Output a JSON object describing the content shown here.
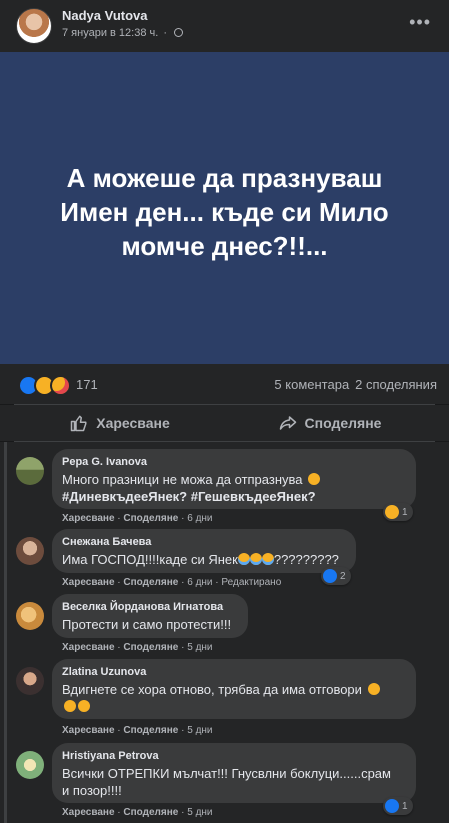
{
  "post": {
    "author": "Nadya Vutova",
    "timestamp": "7 януари в 12:38 ч.",
    "separator": "·",
    "privacy_icon": "globe-icon",
    "more_icon": "more-options-icon",
    "image_text": "А можеше да празнуваш\nИмен ден... къде си Мило\nмомче днес?!!...",
    "image_bg": "#2c3e66"
  },
  "stats": {
    "reactions": [
      "like",
      "sad",
      "care"
    ],
    "reaction_count": "171",
    "comments": "5 коментара",
    "shares": "2 споделяния"
  },
  "actions": {
    "like_label": "Харесване",
    "share_label": "Споделяне"
  },
  "comments": [
    {
      "name": "Pepa G. Ivanova",
      "text_line1": "Много празници не можа да отпразнува ",
      "text_line2": "#ДиневкъдееЯнек? #ГешевкъдееЯнек?",
      "like": "Харесване",
      "reply": "Споделяне",
      "time": "6 дни",
      "reaction_count": "1"
    },
    {
      "name": "Снежана Бачева",
      "text": "Има ГОСПОД!!!!каде си Янек",
      "text_suffix": "?????????",
      "like": "Харесване",
      "reply": "Споделяне",
      "time": "6 дни",
      "edited": "Редактирано",
      "reaction_count": "2"
    },
    {
      "name": "Веселка Йорданова Игнатова",
      "text": "Протести и само протести!!!",
      "like": "Харесване",
      "reply": "Споделяне",
      "time": "5 дни"
    },
    {
      "name": "Zlatina Uzunova",
      "text": "Вдигнете се хора отново, трябва да има отговори ",
      "like": "Харесване",
      "reply": "Споделяне",
      "time": "5 дни"
    },
    {
      "name": "Hristiyana Petrova",
      "text_line1": "Всички ОТРЕПКИ мълчат!!! Гнусвлни боклуци......срам",
      "text_line2": "и позор!!!!",
      "like": "Харесване",
      "reply": "Споделяне",
      "time": "5 дни",
      "reaction_count": "1"
    }
  ],
  "colors": {
    "background": "#242526",
    "bubble": "#3a3b3c",
    "text": "#e4e6eb",
    "secondary": "#b0b3b8",
    "like_blue": "#1877f2"
  }
}
